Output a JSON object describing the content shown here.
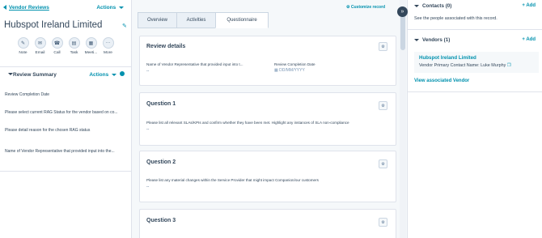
{
  "left": {
    "back_label": "Vendor Reviews",
    "actions_label": "Actions",
    "record_title": "Hubspot Ireland Limited",
    "actions": [
      {
        "label": "Note",
        "icon": "note-icon",
        "glyph": "✎"
      },
      {
        "label": "Email",
        "icon": "email-icon",
        "glyph": "✉"
      },
      {
        "label": "Call",
        "icon": "phone-icon",
        "glyph": "☎"
      },
      {
        "label": "Task",
        "icon": "task-icon",
        "glyph": "▤"
      },
      {
        "label": "Meeti...",
        "icon": "calendar-icon",
        "glyph": "▦"
      },
      {
        "label": "More",
        "icon": "more-icon",
        "glyph": "···"
      }
    ],
    "summary": {
      "title": "Review Summary",
      "actions_label": "Actions",
      "fields": [
        "Review Completion Date",
        "Please select current RAG Status for the vendor based on co...",
        "Please detail reason for the chosen RAG status",
        "Name of Vendor Representative that provided input into the..."
      ]
    }
  },
  "tabs": [
    "Overview",
    "Activities",
    "Questionnaire"
  ],
  "active_tab": "Questionnaire",
  "customize_label": "Customize record",
  "cards": {
    "review": {
      "title": "Review details",
      "field1_label": "Name of Vendor Representative that provided input into t...",
      "field1_value": "--",
      "field2_label": "Review Completion Date",
      "field2_placeholder": "DD/MM/YYYY"
    },
    "q1": {
      "title": "Question 1",
      "text": "Please list all relevant SLAs/KPIs and confirm whether they have been met. Highlight any instances of SLA non-compliance",
      "value": "--"
    },
    "q2": {
      "title": "Question 2",
      "text": "Please list any material changes within the Service Provider that might impact Companion/our customers",
      "value": "--"
    },
    "q3": {
      "title": "Question 3"
    }
  },
  "right": {
    "contacts": {
      "title": "Contacts (0)",
      "add_label": "+ Add",
      "empty_text": "See the people associated with this record."
    },
    "vendors": {
      "title": "Vendors (1)",
      "add_label": "+ Add",
      "vendor_name": "Hubspot Ireland Limited",
      "contact_label": "Vendor Primary Contact Name:",
      "contact_name": "Luke Murphy",
      "view_label": "View associated Vendor"
    }
  },
  "colors": {
    "accent": "#0091ae",
    "text": "#33475b",
    "border": "#dfe3eb"
  }
}
